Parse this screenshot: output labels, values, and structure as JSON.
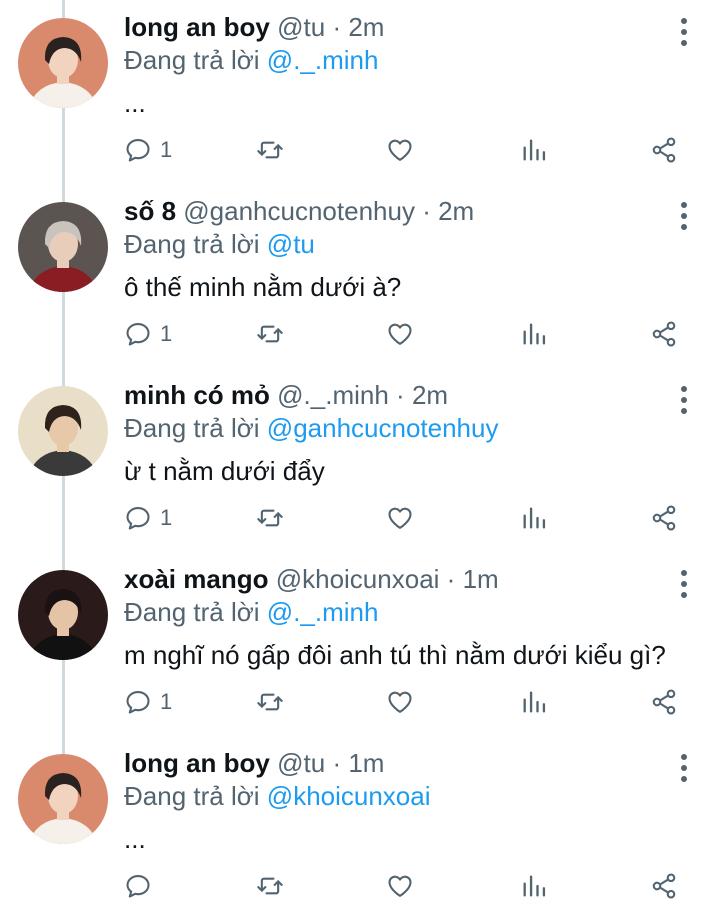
{
  "thread": [
    {
      "name": "long an boy",
      "handle": "@tu",
      "separator": "·",
      "time": "2m",
      "reply_prefix": "Đang trả lời",
      "reply_to": "@._.minh",
      "text": "...",
      "reply_count": "1",
      "avatar_colors": {
        "bg": "#d98a6c",
        "hair": "#2a2220",
        "skin": "#f1d3bf",
        "shirt": "#f5f0ea"
      }
    },
    {
      "name": "số 8",
      "handle": "@ganhcucnotenhuy",
      "separator": "·",
      "time": "2m",
      "reply_prefix": "Đang trả lời",
      "reply_to": "@tu",
      "text": "ô thế minh nằm dưới à?",
      "reply_count": "1",
      "avatar_colors": {
        "bg": "#5b5450",
        "hair": "#c9c3bd",
        "skin": "#e8cdbb",
        "shirt": "#8a1d24"
      }
    },
    {
      "name": "minh có mỏ",
      "handle": "@._.minh",
      "separator": "·",
      "time": "2m",
      "reply_prefix": "Đang trả lời",
      "reply_to": "@ganhcucnotenhuy",
      "text": "ừ t nằm dưới đẩy",
      "reply_count": "1",
      "avatar_colors": {
        "bg": "#e9dfc8",
        "hair": "#2d231c",
        "skin": "#e7c8a8",
        "shirt": "#3a3a3a"
      }
    },
    {
      "name": "xoài mango",
      "handle": "@khoicunxoai",
      "separator": "·",
      "time": "1m",
      "reply_prefix": "Đang trả lời",
      "reply_to": "@._.minh",
      "text": "m nghĩ nó gấp đôi anh tú thì nằm dưới kiểu gì?",
      "reply_count": "1",
      "avatar_colors": {
        "bg": "#2b1a1a",
        "hair": "#1a1212",
        "skin": "#e5c3a6",
        "shirt": "#111111"
      }
    },
    {
      "name": "long an boy",
      "handle": "@tu",
      "separator": "·",
      "time": "1m",
      "reply_prefix": "Đang trả lời",
      "reply_to": "@khoicunxoai",
      "text": "...",
      "reply_count": "",
      "avatar_colors": {
        "bg": "#d98a6c",
        "hair": "#2a2220",
        "skin": "#f1d3bf",
        "shirt": "#f5f0ea"
      }
    }
  ],
  "icons": {
    "reply": "reply-icon",
    "retweet": "retweet-icon",
    "like": "heart-icon",
    "views": "views-icon",
    "share": "share-icon",
    "more": "more-vertical-icon"
  },
  "colors": {
    "mention": "#1d9bf0",
    "secondary": "#536471",
    "thread_line": "#cfd9de"
  }
}
